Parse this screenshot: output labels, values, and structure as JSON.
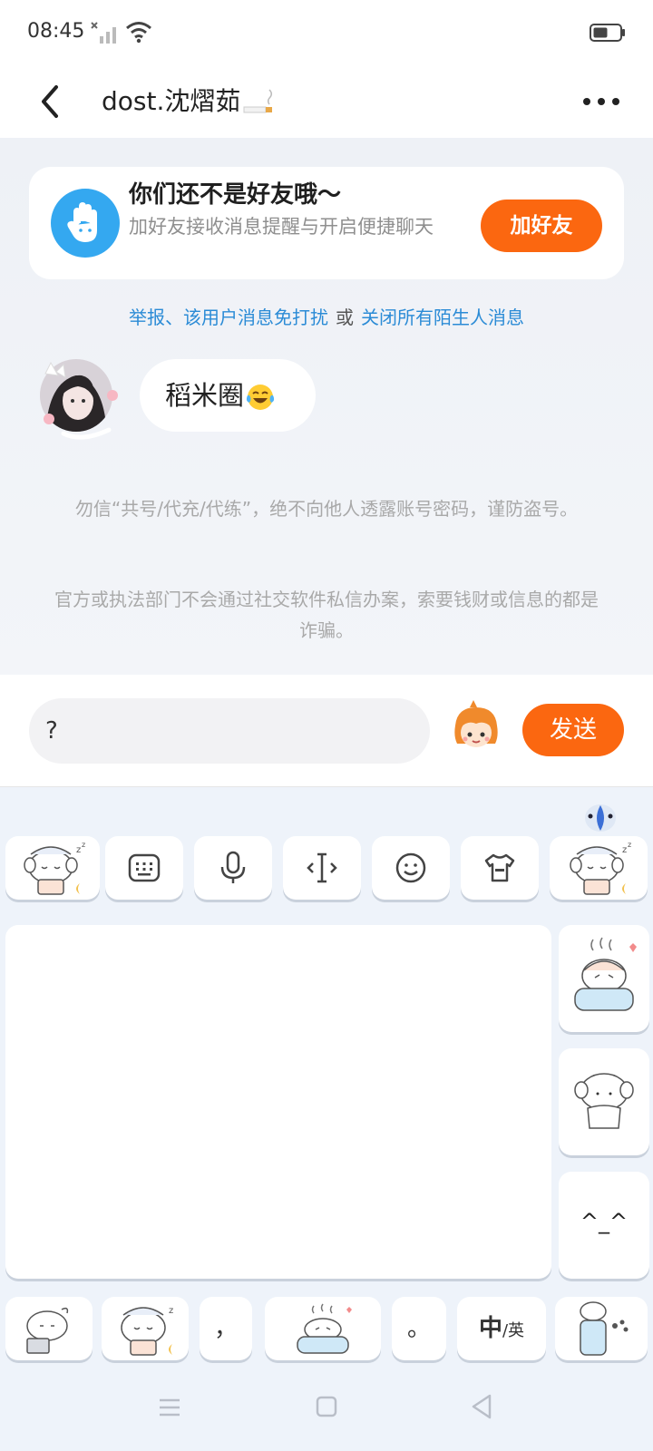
{
  "status_bar": {
    "time": "08:45"
  },
  "header": {
    "title": "dost.沈熠茹"
  },
  "friend_card": {
    "title": "你们还不是好友哦～",
    "description": "加好友接收消息提醒与开启便捷聊天",
    "add_button": "加好友"
  },
  "report_links": {
    "report": "举报、该用户消息免打扰",
    "or": "或",
    "close_all": "关闭所有陌生人消息"
  },
  "messages": [
    {
      "sender": "other",
      "text": "稻米圈"
    }
  ],
  "warnings": [
    "勿信“共号/代充/代练”，绝不向他人透露账号密码，谨防盗号。",
    "官方或执法部门不会通过社交软件私信办案，索要钱财或信息的都是诈骗。"
  ],
  "input_bar": {
    "value": "?",
    "send_label": "发送"
  },
  "keyboard": {
    "side_key_kaomoji": "^_^",
    "bottom_keys": {
      "comma": "，",
      "period": "。",
      "lang_main": "中",
      "lang_alt": "/英"
    },
    "toolbar_icons": [
      "keyboard-icon",
      "microphone-icon",
      "cursor-icon",
      "emoji-face-icon",
      "skin-tshirt-icon"
    ]
  },
  "colors": {
    "accent": "#fb6710",
    "link": "#2b8bd6",
    "hand_icon": "#34a8f0"
  }
}
